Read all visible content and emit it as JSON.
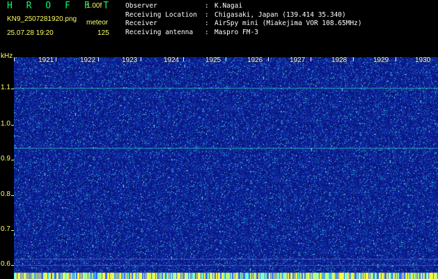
{
  "header": {
    "app_title": "H R O F F T",
    "version": "1.00f",
    "filename": "KN9_2507281920.png",
    "mode": "meteor",
    "datetime": "25.07.28 19:20",
    "count": "125"
  },
  "info": [
    {
      "key": "Observer",
      "value": "K.Nagai"
    },
    {
      "key": "Receiving Location",
      "value": "Chigasaki, Japan (139.414 35.340)"
    },
    {
      "key": "Receiver",
      "value": "AirSpy mini (Miakejima VOR 108.65MHz)"
    },
    {
      "key": "Receiving antenna",
      "value": "Maspro FM-3"
    }
  ],
  "axis": {
    "unit": "kHz",
    "y_labels": [
      "1.1",
      "1.0",
      "0.9",
      "0.8",
      "0.7",
      "0.6"
    ],
    "time_labels": [
      "1921",
      "1922",
      "1923",
      "1924",
      "1925",
      "1926",
      "1927",
      "1928",
      "1929",
      "1930"
    ]
  },
  "colors": {
    "background": "#000000",
    "title": "#00ff66",
    "yellow_text": "#ffff66",
    "white_text": "#ffffff",
    "spectrum_base": "#0a1a8a",
    "signal_line": "#33ddcc"
  }
}
